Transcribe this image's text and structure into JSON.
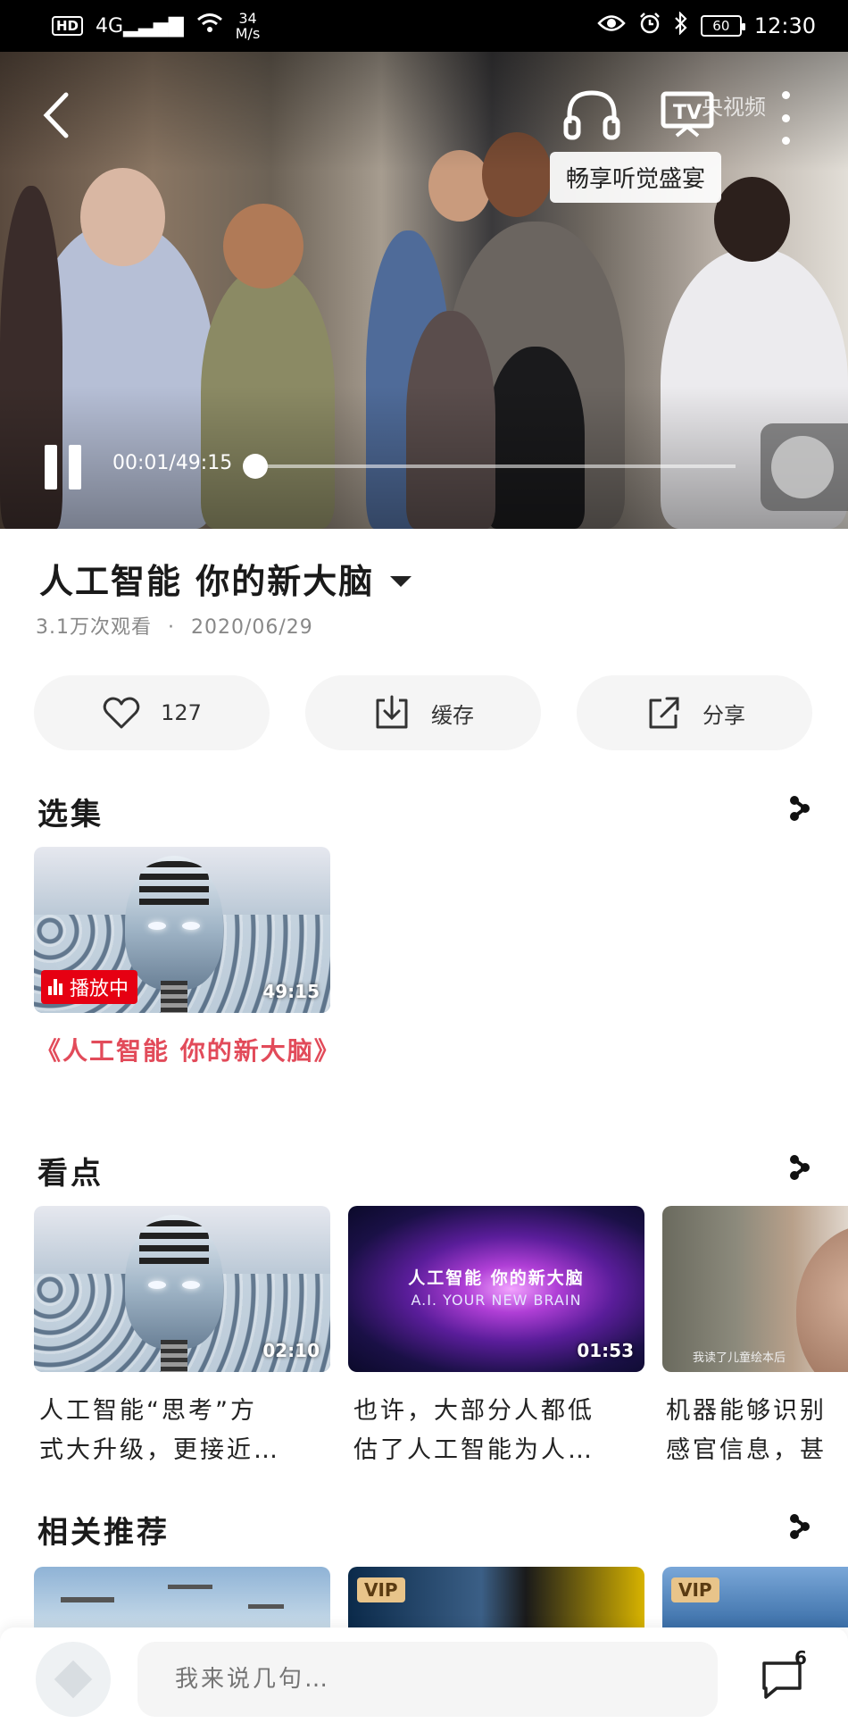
{
  "status_bar": {
    "hd": "HD",
    "network": "4G",
    "speed_value": "34",
    "speed_unit": "M/s",
    "battery": "60",
    "time": "12:30"
  },
  "player": {
    "channel_logo": "央视频",
    "tooltip": "畅享听觉盛宴",
    "timecode": "00:01/49:15",
    "progress": 0.0
  },
  "video": {
    "title": "人工智能 你的新大脑",
    "views": "3.1万次观看",
    "separator": "·",
    "date": "2020/06/29"
  },
  "actions": {
    "like_count": "127",
    "cache_label": "缓存",
    "share_label": "分享"
  },
  "episodes": {
    "title": "选集",
    "item": {
      "duration": "49:15",
      "badge": "播放中",
      "title": "《人工智能 你的新大脑》"
    }
  },
  "highlights": {
    "title": "看点",
    "items": [
      {
        "duration": "02:10",
        "line1": "人工智能“思考”方",
        "line2": "式大升级，更接近…"
      },
      {
        "duration": "01:53",
        "line1": "也许，大部分人都低",
        "line2": "估了人工智能为人…",
        "thumb_title": "人工智能 你的新大脑",
        "thumb_subtitle": "A.I. YOUR NEW BRAIN"
      },
      {
        "line1": "机器能够识别",
        "line2": "感官信息，甚",
        "thumb_subtitle": "我读了儿童绘本后"
      }
    ]
  },
  "related": {
    "title": "相关推荐",
    "vip": "VIP"
  },
  "comment_bar": {
    "placeholder": "我来说几句…",
    "count": "6"
  }
}
